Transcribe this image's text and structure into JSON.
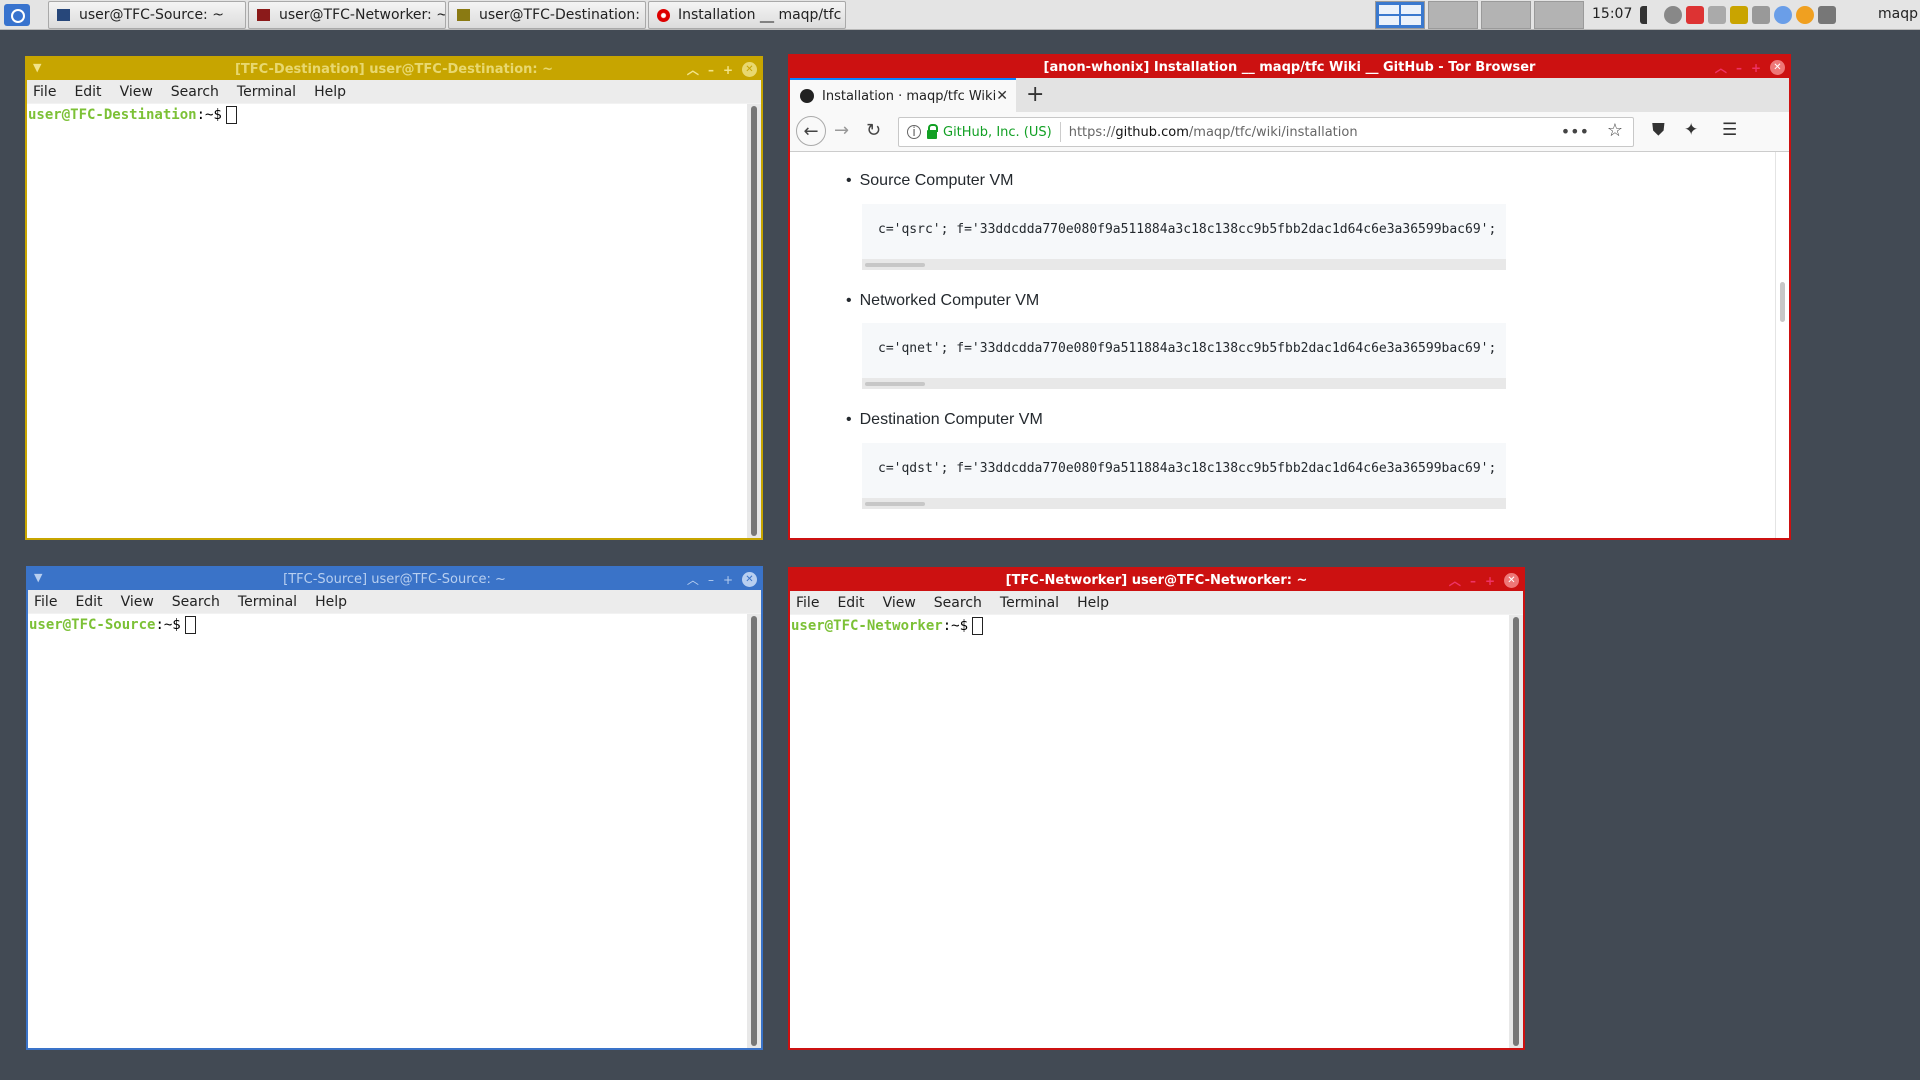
{
  "taskbar": {
    "tasks": [
      {
        "label": "user@TFC-Source: ~",
        "color": "#27477a"
      },
      {
        "label": "user@TFC-Networker: ~",
        "color": "#8b1a1a"
      },
      {
        "label": "user@TFC-Destination: ~",
        "color": "#8a7a12"
      },
      {
        "label": "Installation __ maqp/tfc ...",
        "color": "#cc0000"
      }
    ],
    "clock": "15:07",
    "user": "maqp"
  },
  "windows": {
    "destination": {
      "title": "[TFC-Destination] user@TFC-Destination: ~",
      "accent": "#c7a500",
      "prompt_user": "user@TFC-Destination",
      "prompt_suffix": ":~$"
    },
    "source": {
      "title": "[TFC-Source] user@TFC-Source: ~",
      "accent": "#3a73c8",
      "prompt_user": "user@TFC-Source",
      "prompt_suffix": ":~$"
    },
    "networker": {
      "title": "[TFC-Networker] user@TFC-Networker: ~",
      "accent": "#cc1111",
      "prompt_user": "user@TFC-Networker",
      "prompt_suffix": ":~$"
    },
    "terminal_menu": [
      "File",
      "Edit",
      "View",
      "Search",
      "Terminal",
      "Help"
    ]
  },
  "browser": {
    "title": "[anon-whonix] Installation __ maqp/tfc Wiki __ GitHub - Tor Browser",
    "accent": "#cc1111",
    "tab_label": "Installation · maqp/tfc Wiki",
    "url_identity": "GitHub, Inc. (US)",
    "url_prefix": "https://",
    "url_host": "github.com",
    "url_path": "/maqp/tfc/wiki/installation",
    "sections": [
      {
        "heading": "Source Computer VM",
        "code": "c='qsrc'; f='33ddcdda770e080f9a511884a3c18c138cc9b5fbb2dac1d64c6e3a36599bac69';"
      },
      {
        "heading": "Networked Computer VM",
        "code": "c='qnet'; f='33ddcdda770e080f9a511884a3c18c138cc9b5fbb2dac1d64c6e3a36599bac69';"
      },
      {
        "heading": "Destination Computer VM",
        "code": "c='qdst'; f='33ddcdda770e080f9a511884a3c18c138cc9b5fbb2dac1d64c6e3a36599bac69';"
      }
    ]
  }
}
